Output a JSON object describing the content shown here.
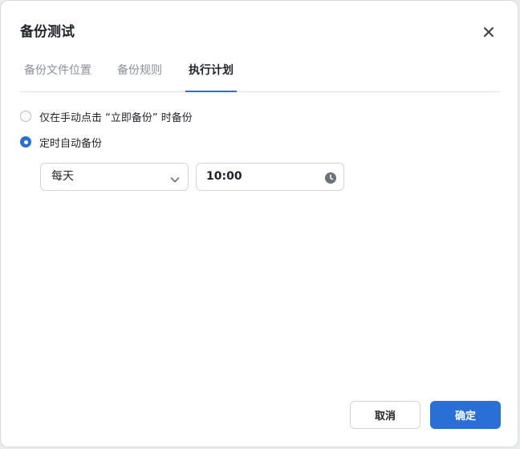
{
  "dialog": {
    "title": "备份测试",
    "close_icon": "close-icon"
  },
  "tabs": [
    {
      "label": "备份文件位置",
      "active": false
    },
    {
      "label": "备份规则",
      "active": false
    },
    {
      "label": "执行计划",
      "active": true
    }
  ],
  "schedule": {
    "options": [
      {
        "label": "仅在手动点击 “立即备份” 时备份",
        "checked": false
      },
      {
        "label": "定时自动备份",
        "checked": true
      }
    ],
    "frequency": {
      "value": "每天",
      "icon": "chevron-down-icon"
    },
    "time": {
      "value": "10:00",
      "icon": "clock-icon"
    }
  },
  "buttons": {
    "cancel": "取消",
    "confirm": "确定"
  },
  "colors": {
    "accent": "#2a6fd6",
    "text": "#1f2329",
    "muted": "#8a9099"
  }
}
